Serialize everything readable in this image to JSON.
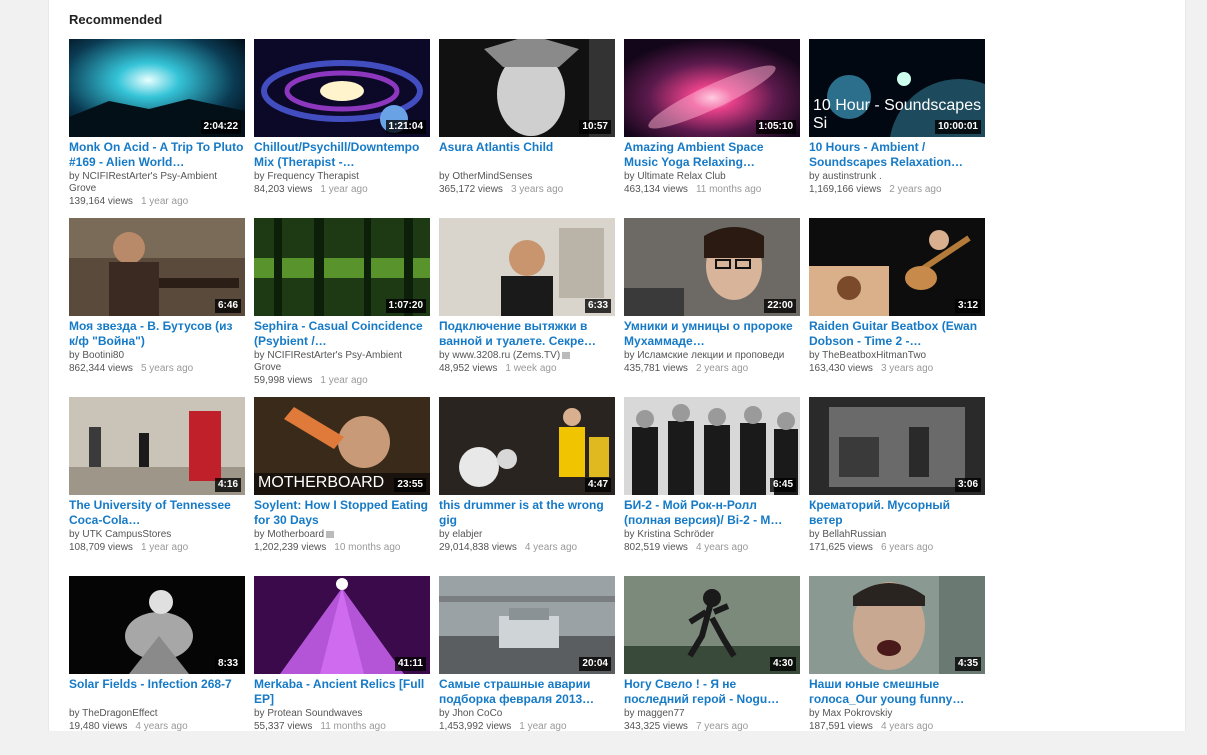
{
  "section": {
    "title": "Recommended"
  },
  "videos": [
    {
      "title": "Monk On Acid - A Trip To Pluto #169 - Alien World…",
      "channel": "NCIFIRestArter's Psy-Ambient Grove",
      "views": "139,164 views",
      "age": "1 year ago",
      "duration": "2:04:22",
      "thumb": "space-teal"
    },
    {
      "title": "Chillout/Psychill/Downtempo Mix (Therapist -…",
      "channel": "Frequency Therapist",
      "views": "84,203 views",
      "age": "1 year ago",
      "duration": "1:21:04",
      "thumb": "galaxy-swirl"
    },
    {
      "title": "Asura Atlantis Child",
      "channel": "OtherMindSenses",
      "views": "365,172 views",
      "age": "3 years ago",
      "duration": "10:57",
      "thumb": "bw-face"
    },
    {
      "title": "Amazing Ambient Space Music Yoga Relaxing…",
      "channel": "Ultimate Relax Club",
      "views": "463,134 views",
      "age": "11 months ago",
      "duration": "1:05:10",
      "thumb": "pink-galaxy"
    },
    {
      "title": "10 Hours - Ambient / Soundscapes Relaxation…",
      "channel": "austinstrunk .",
      "views": "1,169,166 views",
      "age": "2 years ago",
      "duration": "10:00:01",
      "thumb": "planet",
      "caption": "10 Hour - Soundscapes Si"
    },
    {
      "title": "Моя звезда - В. Бутусов (из к/ф \"Война\")",
      "channel": "Bootini80",
      "views": "862,344 views",
      "age": "5 years ago",
      "duration": "6:46",
      "thumb": "war-scene"
    },
    {
      "title": "Sephira - Casual Coincidence (Psybient /…",
      "channel": "NCIFIRestArter's Psy-Ambient Grove",
      "views": "59,998 views",
      "age": "1 year ago",
      "duration": "1:07:20",
      "thumb": "forest"
    },
    {
      "title": "Подключение вытяжки в ванной и туалете. Секре…",
      "channel": "www.3208.ru (Zems.TV)",
      "views": "48,952 views",
      "age": "1 week ago",
      "duration": "6:33",
      "thumb": "man-room",
      "verified": true
    },
    {
      "title": "Умники и умницы о пророке Мухаммаде…",
      "channel": "Исламские лекции и проповеди",
      "views": "435,781 views",
      "age": "2 years ago",
      "duration": "22:00",
      "thumb": "girl-glasses"
    },
    {
      "title": "Raiden Guitar Beatbox (Ewan Dobson - Time 2 -…",
      "channel": "TheBeatboxHitmanTwo",
      "views": "163,430 views",
      "age": "3 years ago",
      "duration": "3:12",
      "thumb": "guitar"
    },
    {
      "title": "The University of Tennessee Coca-Cola…",
      "channel": "UTK CampusStores",
      "views": "108,709 views",
      "age": "1 year ago",
      "duration": "4:16",
      "thumb": "hallway"
    },
    {
      "title": "Soylent: How I Stopped Eating for 30 Days",
      "channel": "Motherboard",
      "views": "1,202,239 views",
      "age": "10 months ago",
      "duration": "23:55",
      "thumb": "drinking",
      "caption": "MOTHERBOARD",
      "verified": true
    },
    {
      "title": "this drummer is at the wrong gig",
      "channel": "elabjer",
      "views": "29,014,838 views",
      "age": "4 years ago",
      "duration": "4:47",
      "thumb": "drummer"
    },
    {
      "title": "БИ-2 - Мой Рок-н-Ролл (полная версия)/ Bi-2 - M…",
      "channel": "Kristina Schröder",
      "views": "802,519 views",
      "age": "4 years ago",
      "duration": "6:45",
      "thumb": "band-bw"
    },
    {
      "title": "Крематорий. Мусорный ветер",
      "channel": "BellahRussian",
      "views": "171,625 views",
      "age": "6 years ago",
      "duration": "3:06",
      "thumb": "old-film"
    },
    {
      "title": "Solar Fields - Infection 268-7",
      "channel": "TheDragonEffect",
      "views": "19,480 views",
      "age": "4 years ago",
      "duration": "8:33",
      "thumb": "dark-figure"
    },
    {
      "title": "Merkaba - Ancient Relics [Full EP]",
      "channel": "Protean Soundwaves",
      "views": "55,337 views",
      "age": "11 months ago",
      "duration": "41:11",
      "thumb": "pyramid"
    },
    {
      "title": "Самые страшные аварии подборка февраля 2013…",
      "channel": "Jhon CoCo",
      "views": "1,453,992 views",
      "age": "1 year ago",
      "duration": "20:04",
      "thumb": "car-crash"
    },
    {
      "title": "Ногу Свело ! - Я не последний герой - Nogu…",
      "channel": "maggen77",
      "views": "343,325 views",
      "age": "7 years ago",
      "duration": "4:30",
      "thumb": "runner"
    },
    {
      "title": "Наши юные смешные голоса_Our young funny…",
      "channel": "Max Pokrovskiy",
      "views": "187,591 views",
      "age": "4 years ago",
      "duration": "4:35",
      "thumb": "singer"
    }
  ]
}
